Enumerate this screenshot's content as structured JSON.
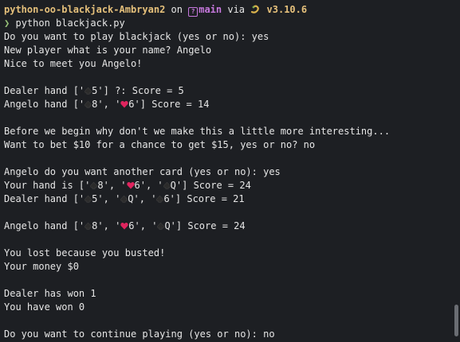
{
  "prompt": {
    "repo": "python-oo-blackjack-Ambryan2",
    "on": "on",
    "branch": "main",
    "via": "via",
    "version": "v3.10.6",
    "command": "python blackjack.py"
  },
  "output": {
    "play_prompt": "Do you want to play blackjack (yes or no): yes",
    "name_prompt": "New player what is your name? Angelo",
    "greeting": "Nice to meet you Angelo!",
    "dealer_hand_1": {
      "prefix": "Dealer hand ['",
      "cards": [
        "5"
      ],
      "suffix": "'] ?: Score = 5"
    },
    "player_hand_1": {
      "prefix": "Angelo hand ['",
      "c1": "8",
      "mid": "', '",
      "c2": "6",
      "suffix": "'] Score = 14"
    },
    "bet_intro": "Before we begin why don't we make this a little more interesting...",
    "bet_prompt": "Want to bet $10 for a chance to get $15, yes or no? no",
    "another_card": "Angelo do you want another card (yes or no): yes",
    "your_hand": {
      "prefix": "Your hand is ['",
      "c1": "8",
      "c2": "6",
      "c3": "Q",
      "suffix": "'] Score = 24"
    },
    "dealer_hand_2": {
      "prefix": "Dealer hand ['",
      "c1": "5",
      "c2": "Q",
      "c3": "6",
      "suffix": "'] Score = 21"
    },
    "player_hand_2": {
      "prefix": "Angelo hand ['",
      "c1": "8",
      "c2": "6",
      "c3": "Q",
      "suffix": "'] Score = 24"
    },
    "sep": "', '",
    "lost": "You lost because you busted!",
    "money": "Your money $0",
    "dealer_won": "Dealer has won 1",
    "you_won": "You have won 0",
    "continue_prompt": "Do you want to continue playing (yes or no): no"
  },
  "colors": {
    "background": "#1d1f23",
    "repo": "#e5c07b",
    "branch": "#c678dd",
    "chevron": "#98c379",
    "heart": "#e0245e",
    "spade": "#2b2b2b"
  },
  "icons": {
    "git_branch": "git-branch-icon",
    "python": "snake-icon",
    "spade": "spade-icon",
    "heart": "heart-icon"
  }
}
